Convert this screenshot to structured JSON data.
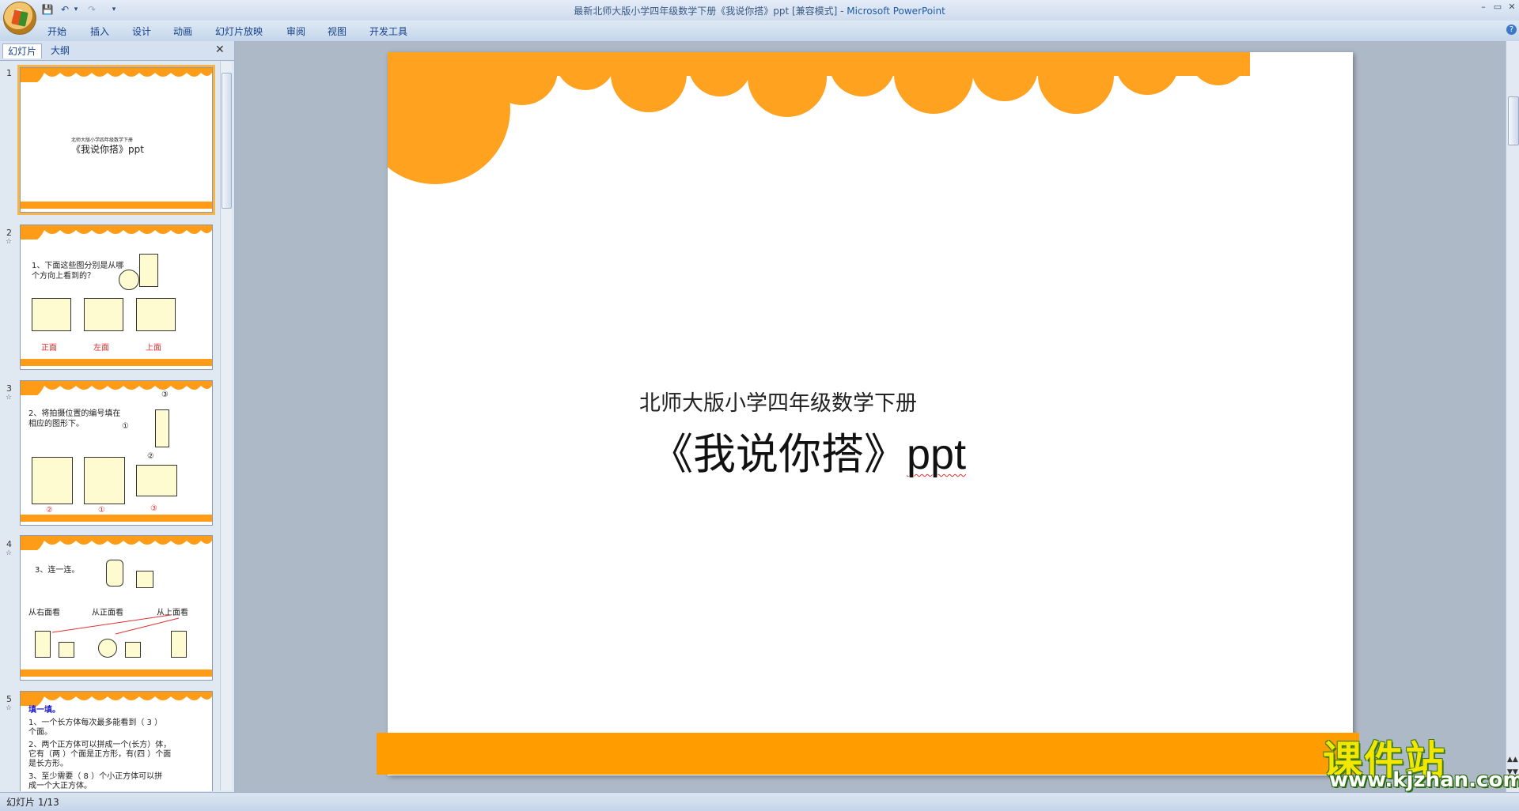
{
  "window": {
    "title": "最新北师大版小学四年级数学下册《我说你搭》ppt [兼容模式] - ",
    "app_name": "Microsoft PowerPoint",
    "minimize": "–",
    "restore": "▭",
    "close": "✕"
  },
  "quick_access": {
    "save": "💾",
    "undo": "↶",
    "redo": "↷",
    "more": "▾"
  },
  "ribbon_tabs": [
    "开始",
    "插入",
    "设计",
    "动画",
    "幻灯片放映",
    "审阅",
    "视图",
    "开发工具"
  ],
  "help_icon": "?",
  "pane_tabs": {
    "slides": "幻灯片",
    "outline": "大纲",
    "close": "✕"
  },
  "thumbnails": [
    {
      "num": "1",
      "subtitle": "北师大版小学四年级数学下册",
      "title": "《我说你搭》ppt"
    },
    {
      "num": "2",
      "star": "☆",
      "text1": "1、下面这些图分别是从哪",
      "text2": "个方向上看到的？",
      "labels": [
        "正面",
        "左面",
        "上面"
      ]
    },
    {
      "num": "3",
      "star": "☆",
      "text1": "2、将拍摄位置的编号填在",
      "text2": "相应的图形下。",
      "markers": [
        "③",
        "①",
        "②"
      ],
      "labels": [
        "②",
        "①",
        "③"
      ]
    },
    {
      "num": "4",
      "star": "☆",
      "text1": "3、连一连。",
      "labels": [
        "从右面看",
        "从正面看",
        "从上面看"
      ]
    },
    {
      "num": "5",
      "star": "☆",
      "heading": "填一填。",
      "line1": "1、一个长方体每次最多能看到（ 3 ）",
      "line1b": "个面。",
      "line2": "2、两个正方体可以拼成一个(长方）体，",
      "line2b": "它有（两 ）个面是正方形，有(四 ）个面",
      "line2c": "是长方形。",
      "line3": "3、至少需要（ 8 ）个小正方体可以拼",
      "line3b": "成一个大正方体。"
    }
  ],
  "slide": {
    "subtitle": "北师大版小学四年级数学下册",
    "title_cn": "《我说你搭》",
    "title_en": "ppt"
  },
  "status": {
    "slide_counter": "幻灯片 1/13"
  },
  "watermark": {
    "cn": "课件站",
    "url": "www.kjzhan.com"
  },
  "colors": {
    "accent_orange": "#ff9c17",
    "ribbon_text": "#15428b",
    "red_label": "#e03030"
  }
}
